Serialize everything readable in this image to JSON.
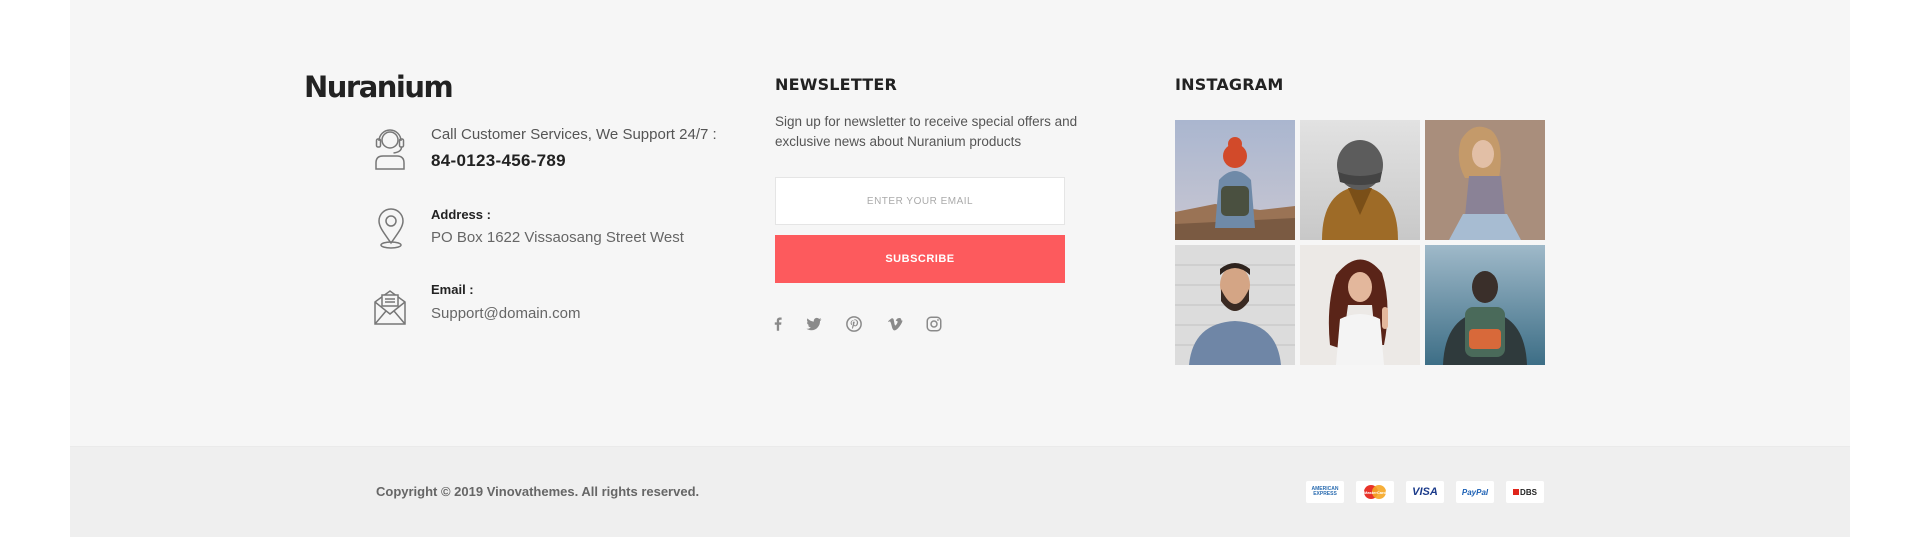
{
  "brand": {
    "name": "Nuranium"
  },
  "contact": {
    "support_label": "Call Customer Services, We Support 24/7 :",
    "phone": "84-0123-456-789",
    "address_label": "Address :",
    "address_value": "PO Box 1622 Vissaosang Street West",
    "email_label": "Email :",
    "email_value": "Support@domain.com"
  },
  "newsletter": {
    "heading": "NEWSLETTER",
    "description": "Sign up for newsletter to receive special offers and exclusive news about Nuranium products",
    "email_placeholder": "ENTER YOUR EMAIL",
    "subscribe_label": "SUBSCRIBE",
    "social_icons": [
      "facebook-icon",
      "twitter-icon",
      "pinterest-icon",
      "vimeo-icon",
      "instagram-icon"
    ]
  },
  "instagram": {
    "heading": "INSTAGRAM"
  },
  "footer": {
    "copyright": "Copyright © 2019 Vinovathemes. All rights reserved.",
    "payments": {
      "amex": "AMERICAN EXPRESS",
      "mastercard": "MasterCard",
      "visa": "VISA",
      "paypal": "PayPal",
      "dbs": "DBS"
    }
  },
  "colors": {
    "accent": "#fd5a5d",
    "background": "#f6f6f6",
    "bottom_bar": "#efefef"
  }
}
